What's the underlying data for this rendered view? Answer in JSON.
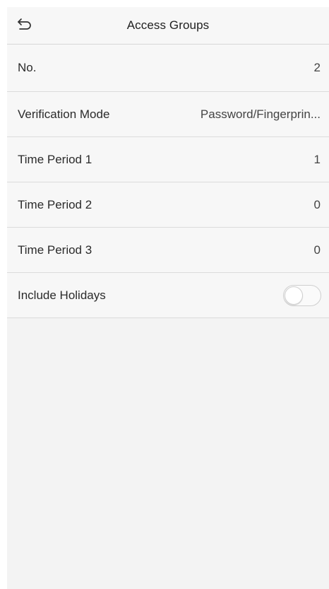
{
  "header": {
    "title": "Access Groups",
    "back_icon": "back-arrow-icon"
  },
  "rows": [
    {
      "label": "No.",
      "value": "2"
    },
    {
      "label": "Verification Mode",
      "value": "Password/Fingerprin..."
    },
    {
      "label": "Time Period 1",
      "value": "1"
    },
    {
      "label": "Time Period 2",
      "value": "0"
    },
    {
      "label": "Time Period 3",
      "value": "0"
    }
  ],
  "holidays": {
    "label": "Include Holidays",
    "enabled": false
  },
  "colors": {
    "background": "#f3f3f3",
    "divider": "#dcdcdc",
    "text": "#2b2b2b"
  }
}
